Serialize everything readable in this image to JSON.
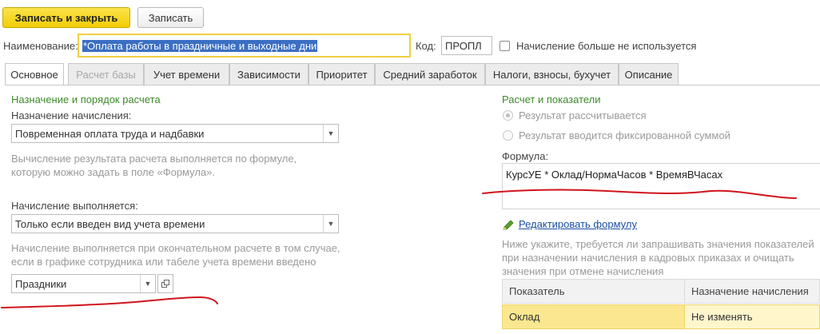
{
  "toolbar": {
    "save_close_label": "Записать и закрыть",
    "save_label": "Записать"
  },
  "header": {
    "name_label": "Наименование:",
    "name_value": "*Оплата работы в праздничные и выходные дни",
    "code_label": "Код:",
    "code_value": "ПРОПЛ",
    "unused_label": "Начисление больше не используется"
  },
  "tabs": [
    {
      "label": "Основное",
      "state": "active"
    },
    {
      "label": "Расчет базы",
      "state": "disabled"
    },
    {
      "label": "Учет времени",
      "state": "normal"
    },
    {
      "label": "Зависимости",
      "state": "normal"
    },
    {
      "label": "Приоритет",
      "state": "normal"
    },
    {
      "label": "Средний заработок",
      "state": "normal"
    },
    {
      "label": "Налоги, взносы, бухучет",
      "state": "normal"
    },
    {
      "label": "Описание",
      "state": "normal"
    }
  ],
  "left": {
    "section_title": "Назначение и порядок расчета",
    "purpose_label": "Назначение начисления:",
    "purpose_value": "Повременная оплата труда и надбавки",
    "formula_hint_line1": "Вычисление результата расчета выполняется по формуле,",
    "formula_hint_line2": "которую можно задать в поле «Формула».",
    "performed_label": "Начисление выполняется:",
    "performed_value": "Только если введен вид учета времени",
    "final_hint_line1": "Начисление выполняется при окончательном расчете в том случае,",
    "final_hint_line2": "если в графике сотрудника или табеле учета времени введено",
    "holidays_value": "Праздники"
  },
  "right": {
    "section_title": "Расчет и показатели",
    "radio_calculated": "Результат рассчитывается",
    "radio_fixed": "Результат вводится фиксированной суммой",
    "formula_label": "Формула:",
    "formula_value": "КурсУЕ * Оклад/НормаЧасов * ВремяВЧасах",
    "edit_formula_link": "Редактировать формулу",
    "indicators_hint_line1": "Ниже укажите, требуется ли запрашивать значения показателей",
    "indicators_hint_line2": "при назначении начисления в кадровых приказах и очищать",
    "indicators_hint_line3": "значения при отмене начисления",
    "table": {
      "headers": [
        "Показатель",
        "Назначение начисления"
      ],
      "rows": [
        [
          "Оклад",
          "Не изменять"
        ]
      ]
    }
  },
  "colors": {
    "primary_button": "#f2cd07",
    "section_title": "#3c8a2a",
    "link": "#1a4fa3",
    "selected_row": "#fae78f",
    "annotation": "#d0141c"
  },
  "icons": {
    "dropdown": "triangle-down",
    "open": "open-form-icon",
    "edit": "pencil-icon"
  }
}
